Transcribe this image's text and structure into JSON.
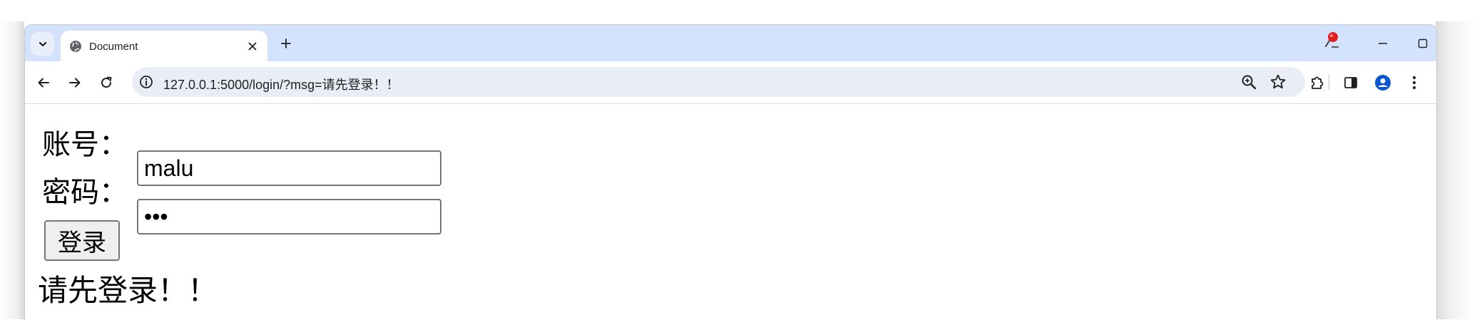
{
  "browser": {
    "tab_title": "Document",
    "url": "127.0.0.1:5000/login/?msg=请先登录！！",
    "accent": "#d3e3fd",
    "profile_color": "#0b57d0"
  },
  "form": {
    "account_label": "账号：",
    "account_value": "malu",
    "password_label": "密码：",
    "password_masked": "•••",
    "submit_label": "登录"
  },
  "message": "请先登录！！"
}
